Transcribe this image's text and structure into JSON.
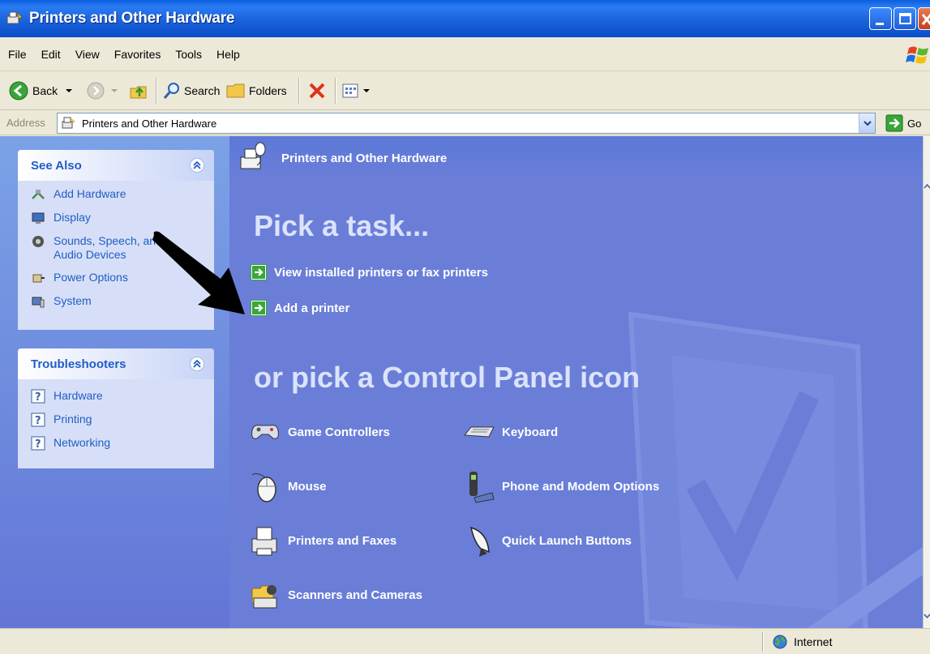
{
  "window": {
    "title": "Printers and Other Hardware"
  },
  "menu": [
    "File",
    "Edit",
    "View",
    "Favorites",
    "Tools",
    "Help"
  ],
  "toolbar": {
    "back_label": "Back",
    "search_label": "Search",
    "folders_label": "Folders"
  },
  "address": {
    "label": "Address",
    "value": "Printers and Other Hardware",
    "go_label": "Go"
  },
  "see_also": {
    "title": "See Also",
    "items": [
      {
        "label": "Add Hardware",
        "icon": "add-hardware-icon"
      },
      {
        "label": "Display",
        "icon": "display-icon"
      },
      {
        "label": "Sounds, Speech, and Audio Devices",
        "icon": "sounds-icon"
      },
      {
        "label": "Power Options",
        "icon": "power-options-icon"
      },
      {
        "label": "System",
        "icon": "system-icon"
      }
    ]
  },
  "troubleshooters": {
    "title": "Troubleshooters",
    "items": [
      {
        "label": "Hardware",
        "icon": "help-icon"
      },
      {
        "label": "Printing",
        "icon": "help-icon"
      },
      {
        "label": "Networking",
        "icon": "help-icon"
      }
    ]
  },
  "main": {
    "header_title": "Printers and Other Hardware",
    "pick_task_heading": "Pick a task...",
    "tasks": [
      {
        "label": "View installed printers or fax printers"
      },
      {
        "label": "Add a printer"
      }
    ],
    "pick_icon_heading": "or pick a Control Panel icon",
    "icons": [
      {
        "label": "Game Controllers",
        "icon": "game-controller-icon"
      },
      {
        "label": "Keyboard",
        "icon": "keyboard-icon"
      },
      {
        "label": "Mouse",
        "icon": "mouse-icon"
      },
      {
        "label": "Phone and Modem Options",
        "icon": "phone-icon"
      },
      {
        "label": "Printers and Faxes",
        "icon": "printer-icon"
      },
      {
        "label": "Quick Launch Buttons",
        "icon": "rocket-icon"
      },
      {
        "label": "Scanners and Cameras",
        "icon": "scanner-icon"
      }
    ]
  },
  "status": {
    "zone": "Internet"
  },
  "colors": {
    "titlebar_blue": "#0a5fe0",
    "panel_blue": "#6a7ed8",
    "link_blue": "#215dc6",
    "chrome_beige": "#ece9d8"
  }
}
